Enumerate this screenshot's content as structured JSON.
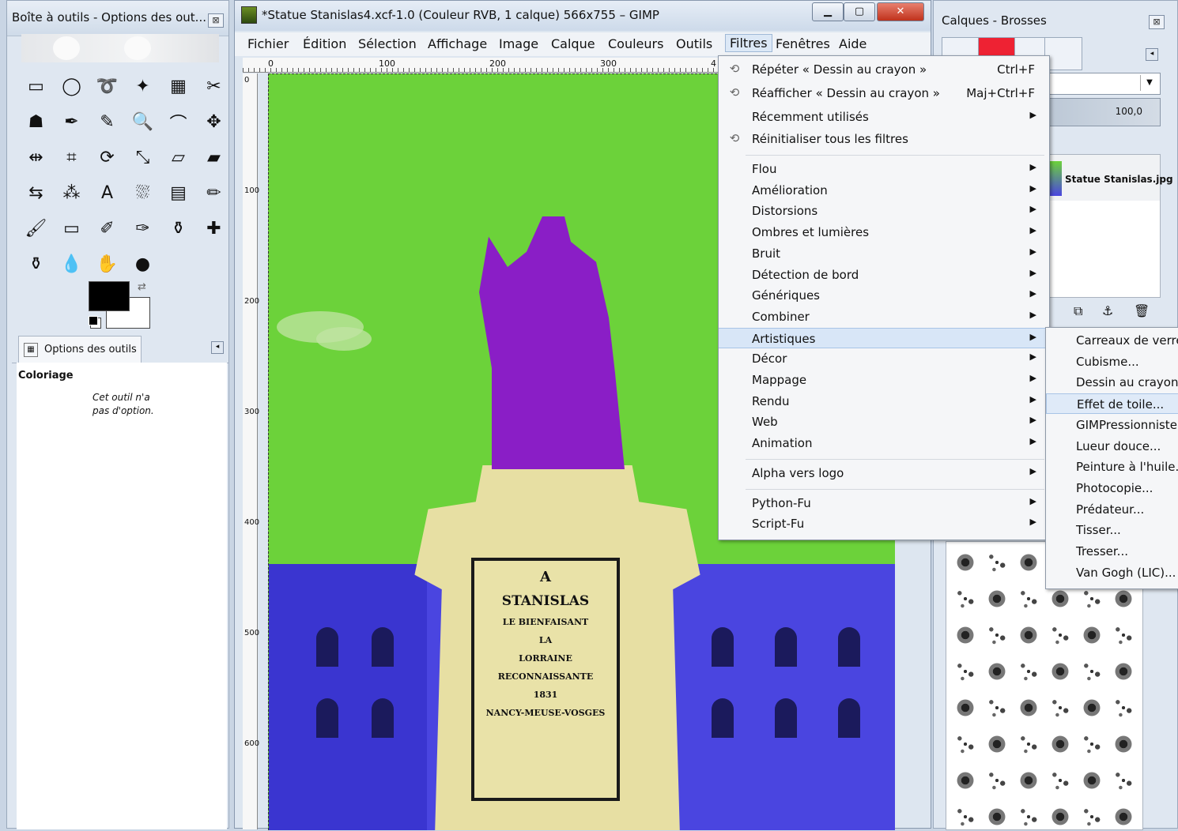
{
  "toolbox": {
    "title": "Boîte à outils - Options des out...",
    "close": "⊠",
    "tool_icons": [
      "rect-select-icon",
      "ellipse-select-icon",
      "lasso-icon",
      "fuzzy-select-icon",
      "color-select-icon",
      "scissors-icon",
      "foreground-select-icon",
      "paths-icon",
      "color-picker-icon",
      "zoom-icon",
      "measure-icon",
      "move-icon",
      "align-icon",
      "crop-icon",
      "rotate-icon",
      "scale-icon",
      "shear-icon",
      "perspective-icon",
      "flip-icon",
      "cage-icon",
      "text-icon",
      "bucket-fill-icon",
      "blend-icon",
      "pencil-icon",
      "paintbrush-icon",
      "eraser-icon",
      "airbrush-icon",
      "ink-icon",
      "clone-icon",
      "heal-icon",
      "perspective-clone-icon",
      "blur-icon",
      "smudge-icon",
      "dodge-burn-icon"
    ],
    "tool_glyphs": [
      "▭",
      "◯",
      "➰",
      "✦",
      "▦",
      "✂",
      "☗",
      "✒",
      "✎",
      "🔍",
      "⌒",
      "✥",
      "⇹",
      "⌗",
      "⟳",
      "⤡",
      "▱",
      "▰",
      "⇆",
      "⁂",
      "A",
      "⛆",
      "▤",
      "✏",
      "🖌",
      "▭",
      "✐",
      "✑",
      "⚱",
      "✚",
      "⚱",
      "💧",
      "✋",
      "●"
    ],
    "fg_color": "#000000",
    "bg_color": "#ffffff",
    "tab_label": "Options des outils",
    "section_title": "Coloriage",
    "no_options": "Cet outil n'a\npas d'option."
  },
  "image_window": {
    "title": "*Statue Stanislas4.xcf-1.0 (Couleur RVB, 1 calque) 566x755 – GIMP",
    "menus": [
      "Fichier",
      "Édition",
      "Sélection",
      "Affichage",
      "Image",
      "Calque",
      "Couleurs",
      "Outils",
      "Filtres",
      "Fenêtres",
      "Aide"
    ],
    "active_menu": "Filtres",
    "ruler_h": [
      "0",
      "100",
      "200",
      "300",
      "4"
    ],
    "ruler_v": [
      "0",
      "100",
      "200",
      "300",
      "400",
      "500",
      "600"
    ],
    "plaque_lines": [
      "A",
      "STANISLAS",
      "LE BIENFAISANT",
      "LA",
      "LORRAINE",
      "RECONNAISSANTE",
      "1831",
      "NANCY-MEUSE-VOSGES"
    ]
  },
  "filters_menu": {
    "top_items": [
      {
        "label": "Répéter « Dessin au crayon »",
        "shortcut": "Ctrl+F",
        "icon": "repeat-icon"
      },
      {
        "label": "Réafficher « Dessin au crayon »",
        "shortcut": "Maj+Ctrl+F",
        "icon": "reshow-icon"
      },
      {
        "label": "Récemment utilisés",
        "submenu": true
      },
      {
        "label": "Réinitialiser tous les filtres",
        "icon": "reset-icon"
      }
    ],
    "groups": [
      [
        "Flou",
        "Amélioration",
        "Distorsions",
        "Ombres et lumières",
        "Bruit",
        "Détection de bord",
        "Génériques",
        "Combiner",
        "Artistiques",
        "Décor",
        "Mappage",
        "Rendu",
        "Web",
        "Animation"
      ],
      [
        "Alpha vers logo"
      ],
      [
        "Python-Fu",
        "Script-Fu"
      ]
    ],
    "highlighted": "Artistiques"
  },
  "artistic_submenu": {
    "items": [
      "Carreaux de verre...",
      "Cubisme...",
      "Dessin au crayon...",
      "Effet de toile...",
      "GIMPressionniste...",
      "Lueur douce...",
      "Peinture à l'huile...",
      "Photocopie...",
      "Prédateur...",
      "Tisser...",
      "Tresser...",
      "Van Gogh (LIC)..."
    ],
    "highlighted": "Effet de toile..."
  },
  "dock": {
    "title": "Calques - Brosses",
    "close": "⊠",
    "opacity_value": "100,0",
    "layer_name": "Statue Stanislas.jpg"
  }
}
